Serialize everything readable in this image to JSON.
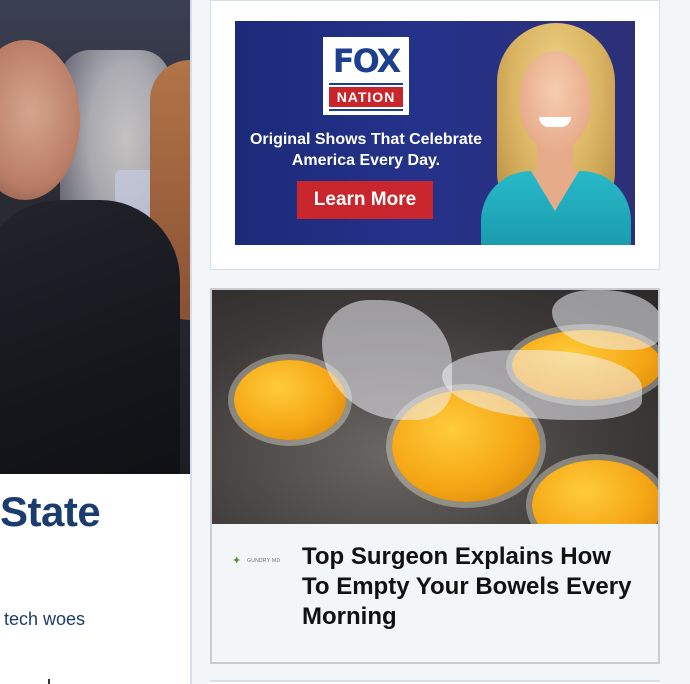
{
  "main_article": {
    "headline_partial": "State",
    "subtext_partial": "tech woes"
  },
  "ad": {
    "brand_top": "FOX",
    "brand_bottom": "NATION",
    "tagline": "Original Shows That Celebrate America Every Day.",
    "cta_label": "Learn More",
    "colors": {
      "background": "#24328a",
      "cta": "#c8262c",
      "dress": "#27b9c8"
    }
  },
  "sponsored_story": {
    "sponsor_name": "GUNDRY MD",
    "title": "Top Surgeon Explains How To Empty Your Bowels Every Morning"
  }
}
